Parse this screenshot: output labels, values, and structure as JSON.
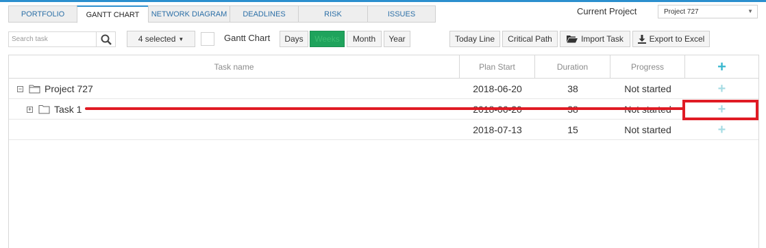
{
  "tabs": [
    {
      "label": "PORTFOLIO"
    },
    {
      "label": "GANTT CHART"
    },
    {
      "label": "NETWORK DIAGRAM"
    },
    {
      "label": "DEADLINES"
    },
    {
      "label": "RISK"
    },
    {
      "label": "ISSUES"
    }
  ],
  "active_tab": "GANTT CHART",
  "project": {
    "label": "Current Project",
    "selected": "Project 727"
  },
  "toolbar": {
    "search_placeholder": "Search task",
    "selected_dropdown": "4 selected",
    "gantt_label": "Gantt Chart",
    "scale_buttons": [
      "Days",
      "Weeks",
      "Month",
      "Year"
    ],
    "active_scale": "Weeks",
    "today_line": "Today Line",
    "critical_path": "Critical Path",
    "import_task": "Import Task",
    "export_excel": "Export to Excel"
  },
  "grid": {
    "headers": [
      "Task name",
      "Plan Start",
      "Duration",
      "Progress"
    ],
    "rows": [
      {
        "name": "Project 727",
        "start": "2018-06-20",
        "duration": "38",
        "progress": "Not started"
      },
      {
        "name": "Task 1",
        "start": "2018-06-20",
        "duration": "38",
        "progress": "Not started"
      },
      {
        "name": "",
        "start": "2018-07-13",
        "duration": "15",
        "progress": "Not started"
      }
    ]
  },
  "colors": {
    "accent": "#2c8fce",
    "active_scale": "#1fa35c",
    "annotation": "#e01b24",
    "add_icon": "#3ab8cf"
  }
}
